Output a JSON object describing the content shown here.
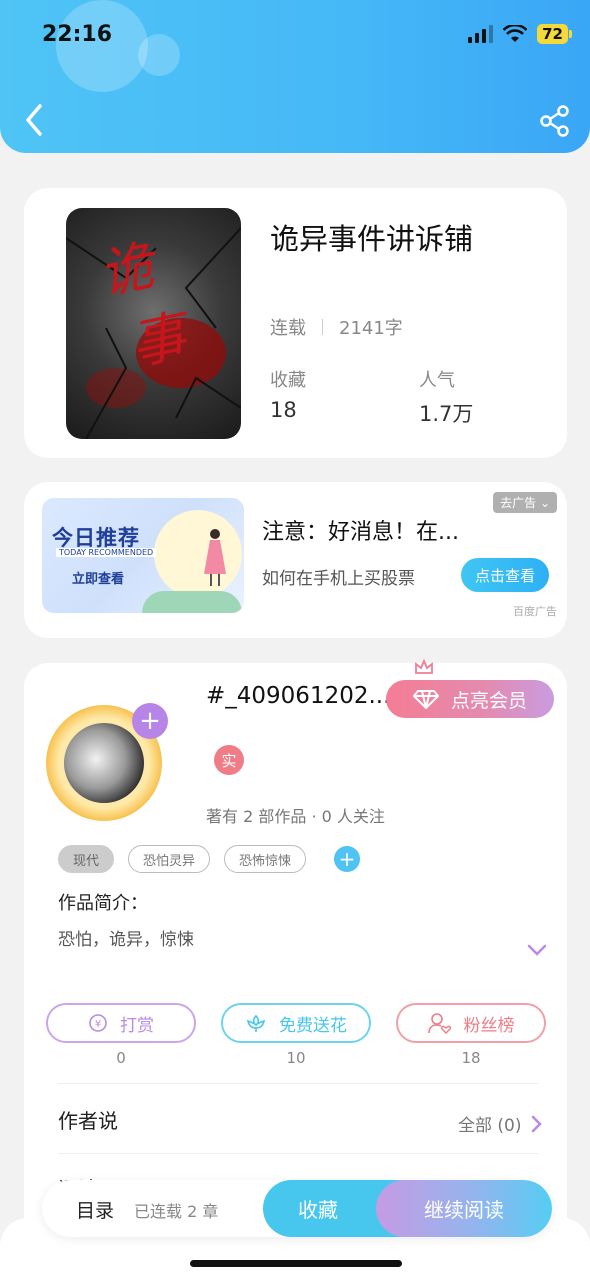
{
  "status_bar": {
    "time": "22:16",
    "battery": "72"
  },
  "book": {
    "title": "诡异事件讲诉铺",
    "status": "连载",
    "word_count": "2141字",
    "cover_text": [
      "诡",
      "事"
    ],
    "stats": [
      {
        "label": "收藏",
        "value": "18"
      },
      {
        "label": "人气",
        "value": "1.7万"
      }
    ]
  },
  "ad": {
    "image_title": "今日推荐",
    "image_subtitle": "TODAY RECOMMENDED",
    "image_cta": "立即查看",
    "close_label": "去广告",
    "title": "注意：好消息！在...",
    "description": "如何在手机上买股票",
    "button": "点击查看",
    "source": "百度广告"
  },
  "author": {
    "name": "#_409061202...",
    "vip_button": "点亮会员",
    "real_badge": "实",
    "works_line": "著有 2 部作品 · 0 人关注",
    "tags": [
      "现代",
      "恐怕灵异",
      "恐怖惊悚"
    ],
    "intro_label": "作品简介：",
    "intro_text": "恐怕，诡异，惊悚",
    "actions": [
      {
        "label": "打赏",
        "count": "0",
        "color": "#b98ae4"
      },
      {
        "label": "免费送花",
        "count": "10",
        "color": "#47c6ee"
      },
      {
        "label": "粉丝榜",
        "count": "18",
        "color": "#ef7c86"
      }
    ],
    "author_says": "作者说",
    "all_link": "全部 (0)",
    "comment_peek": "评论"
  },
  "bottom_bar": {
    "toc": "目录",
    "chapters": "已连载 2 章",
    "favorite": "收藏",
    "continue": "继续阅读"
  }
}
